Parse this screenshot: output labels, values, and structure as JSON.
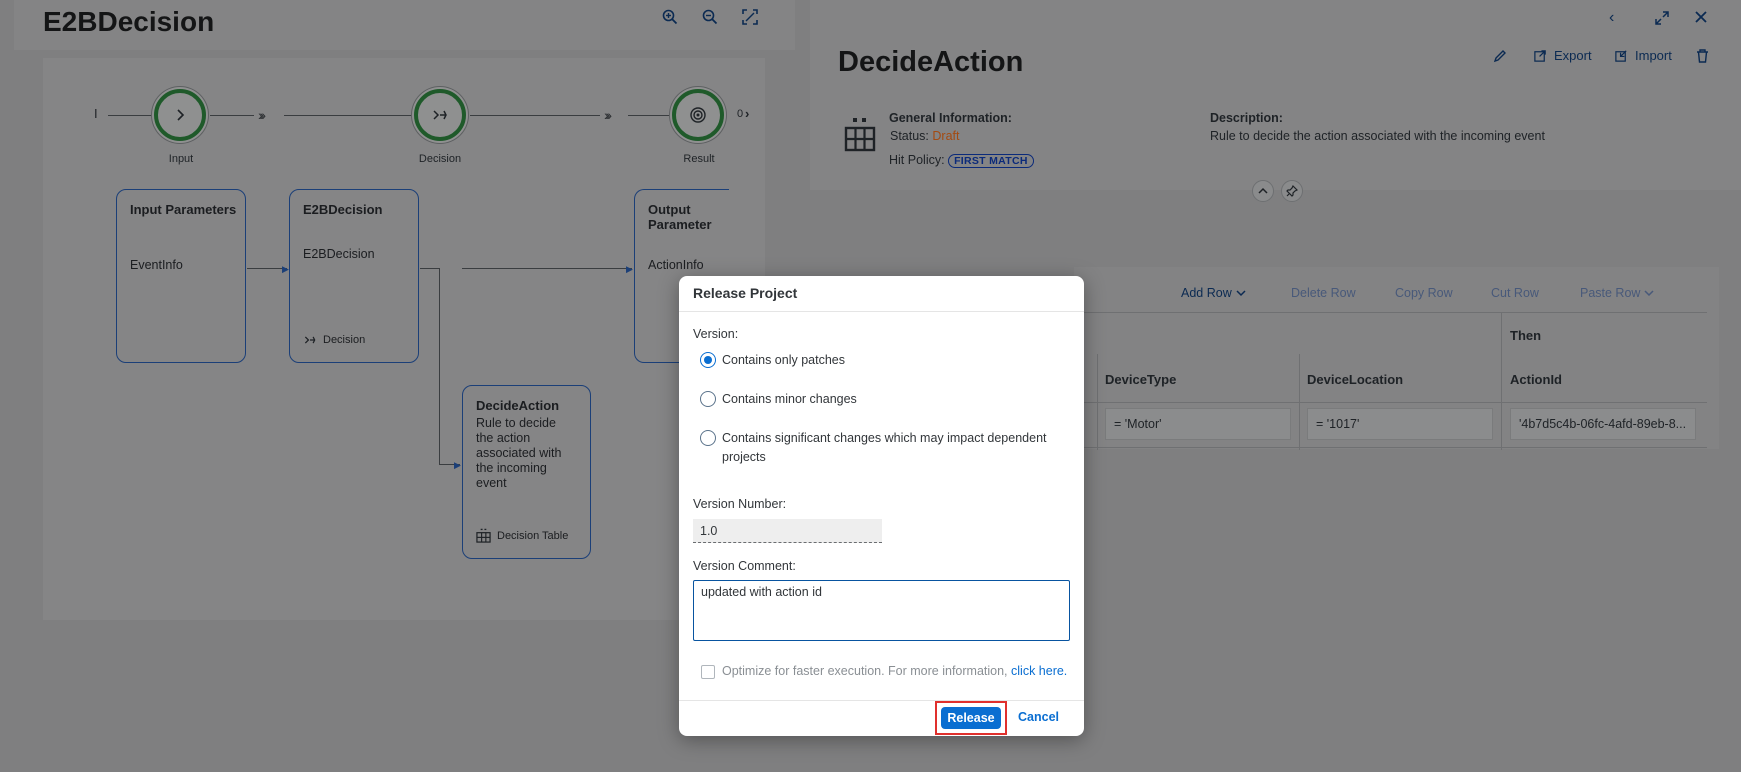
{
  "left": {
    "title": "E2BDecision",
    "flow": {
      "start_marker": "I",
      "end_marker": "0",
      "nodes": [
        {
          "label": "Input",
          "icon": "chevron-right-icon"
        },
        {
          "label": "Decision",
          "icon": "decision-icon"
        },
        {
          "label": "Result",
          "icon": "target-icon"
        }
      ]
    },
    "boxes": {
      "input": {
        "title": "Input Parameters",
        "text": "EventInfo"
      },
      "decision": {
        "title": "E2BDecision",
        "text": "E2BDecision",
        "footer": "Decision"
      },
      "output": {
        "title": "Output Parameter",
        "text": "ActionInfo"
      },
      "decide_action": {
        "title": "DecideAction",
        "text": "Rule to decide the action associated with the incoming event",
        "footer": "Decision Table"
      }
    }
  },
  "right": {
    "title": "DecideAction",
    "toolbar": {
      "export_label": "Export",
      "import_label": "Import"
    },
    "general_info": {
      "heading": "General Information:",
      "status_label": "Status:",
      "status_value": "Draft",
      "hit_policy_label": "Hit Policy:",
      "hit_policy_value": "FIRST MATCH"
    },
    "description": {
      "label": "Description:",
      "text": "Rule to decide the action associated with the incoming event"
    },
    "table": {
      "actions": {
        "add_row": "Add Row",
        "delete_row": "Delete Row",
        "copy_row": "Copy Row",
        "cut_row": "Cut Row",
        "paste_row": "Paste Row"
      },
      "then_label": "Then",
      "columns": [
        "DeviceType",
        "DeviceLocation",
        "ActionId"
      ],
      "rows": [
        [
          "= 'Motor'",
          "= '1017'",
          "'4b7d5c4b-06fc-4afd-89eb-8..."
        ]
      ]
    }
  },
  "dialog": {
    "title": "Release Project",
    "version_label": "Version:",
    "options": [
      {
        "label": "Contains only patches",
        "selected": true
      },
      {
        "label": "Contains minor changes",
        "selected": false
      },
      {
        "label": "Contains significant changes which may impact dependent projects",
        "selected": false
      }
    ],
    "version_number_label": "Version Number:",
    "version_number_value": "1.0",
    "version_comment_label": "Version Comment:",
    "version_comment_value": "updated with action id",
    "optimize_text": "Optimize for faster execution. For more information,",
    "optimize_link": "click here.",
    "release_label": "Release",
    "cancel_label": "Cancel"
  },
  "colors": {
    "accent": "#0a6ed1",
    "highlight": "#e0302d",
    "overlay": "#7f7f80",
    "draft": "#a44a10"
  }
}
